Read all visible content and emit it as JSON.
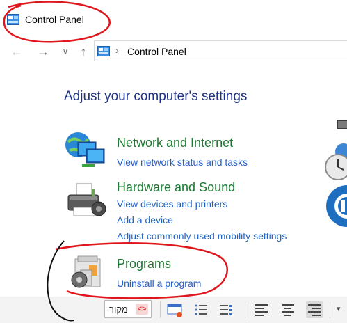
{
  "window": {
    "title": "Control Panel"
  },
  "address_bar": {
    "path": "Control Panel"
  },
  "main": {
    "heading": "Adjust your computer's settings",
    "categories": [
      {
        "title": "Network and Internet",
        "icon": "network-globe-icon",
        "links": [
          "View network status and tasks"
        ]
      },
      {
        "title": "Hardware and Sound",
        "icon": "printer-icon",
        "links": [
          "View devices and printers",
          "Add a device",
          "Adjust commonly used mobility settings"
        ]
      },
      {
        "title": "Programs",
        "icon": "programs-box-icon",
        "links": [
          "Uninstall a program"
        ]
      }
    ]
  },
  "toolbar": {
    "source_label": "מקור"
  },
  "colors": {
    "heading": "#1e3287",
    "category_title": "#1e7a32",
    "link": "#2262c6",
    "annotation": "#e0161d"
  }
}
